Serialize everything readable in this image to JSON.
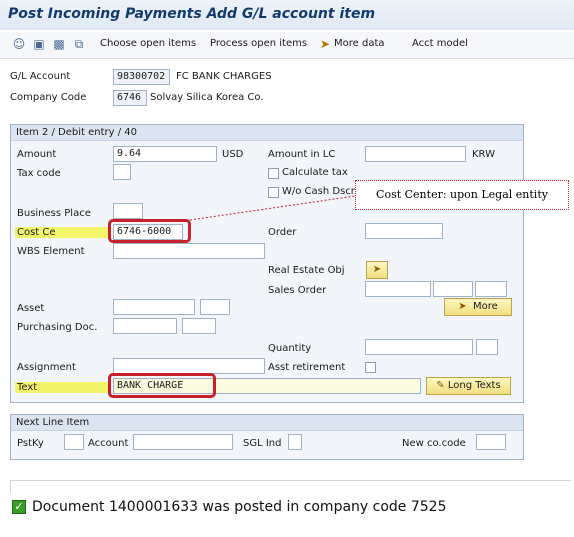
{
  "window": {
    "title": "Post Incoming Payments Add G/L account item"
  },
  "toolbar": {
    "icons": [
      "person-icon",
      "save-icon",
      "save-variant-icon",
      "copy-icon"
    ],
    "buttons": [
      "Choose open items",
      "Process open items",
      "More data",
      "Acct model"
    ]
  },
  "header": {
    "gl_account_label": "G/L Account",
    "gl_account_value": "98300702",
    "gl_account_desc": "FC BANK CHARGES",
    "company_code_label": "Company Code",
    "company_code_value": "6746",
    "company_code_desc": "Solvay Silica Korea Co."
  },
  "item": {
    "title": "Item 2 / Debit entry / 40",
    "amount_label": "Amount",
    "amount_value": "9.64",
    "amount_currency": "USD",
    "amount_lc_label": "Amount in LC",
    "amount_lc_value": "",
    "amount_lc_currency": "KRW",
    "tax_code_label": "Tax code",
    "calculate_tax_label": "Calculate tax",
    "wo_cash_label": "W/o Cash Dscnt",
    "business_place_label": "Business Place",
    "cost_center_label": "Cost Center",
    "cost_center_value": "6746-6000",
    "order_label": "Order",
    "wbs_label": "WBS Element",
    "real_estate_label": "Real Estate Obj",
    "sales_order_label": "Sales Order",
    "more_button": "More",
    "asset_label": "Asset",
    "purchasing_doc_label": "Purchasing Doc.",
    "quantity_label": "Quantity",
    "assignment_label": "Assignment",
    "asst_retirement_label": "Asst retirement",
    "text_label": "Text",
    "text_value": "BANK CHARGE",
    "long_texts_button": "Long Texts"
  },
  "next_line": {
    "title": "Next Line Item",
    "pstky_label": "PstKy",
    "account_label": "Account",
    "sgl_ind_label": "SGL Ind",
    "new_co_code_label": "New co.code"
  },
  "annotation": {
    "callout": "Cost Center: upon Legal entity"
  },
  "status": {
    "message": "Document 1400001633 was posted in company code 7525"
  },
  "colors": {
    "highlight": "#f2f56a",
    "annotation_red": "#c8202a",
    "title_blue": "#123a70"
  }
}
